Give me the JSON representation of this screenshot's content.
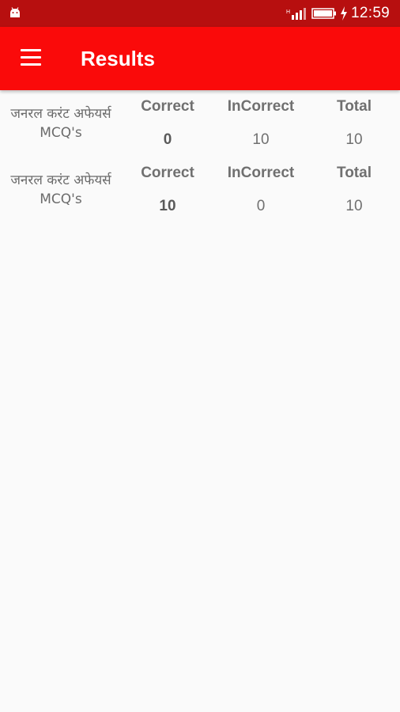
{
  "status_bar": {
    "time": "12:59",
    "icons": [
      "android-icon",
      "signal-icon",
      "battery-icon",
      "charging-bolt-icon"
    ]
  },
  "app_bar": {
    "title": "Results",
    "menu_icon": "hamburger-menu-icon"
  },
  "colors": {
    "status_bar": "#b70f0f",
    "app_bar": "#fa0a0a",
    "background": "#fafafa",
    "text": "#707070"
  },
  "results": [
    {
      "name": "जनरल करंट अफेयर्स MCQ's",
      "headers": {
        "correct": "Correct",
        "incorrect": "InCorrect",
        "total": "Total"
      },
      "correct": "0",
      "incorrect": "10",
      "total": "10"
    },
    {
      "name": "जनरल करंट अफेयर्स MCQ's",
      "headers": {
        "correct": "Correct",
        "incorrect": "InCorrect",
        "total": "Total"
      },
      "correct": "10",
      "incorrect": "0",
      "total": "10"
    }
  ]
}
